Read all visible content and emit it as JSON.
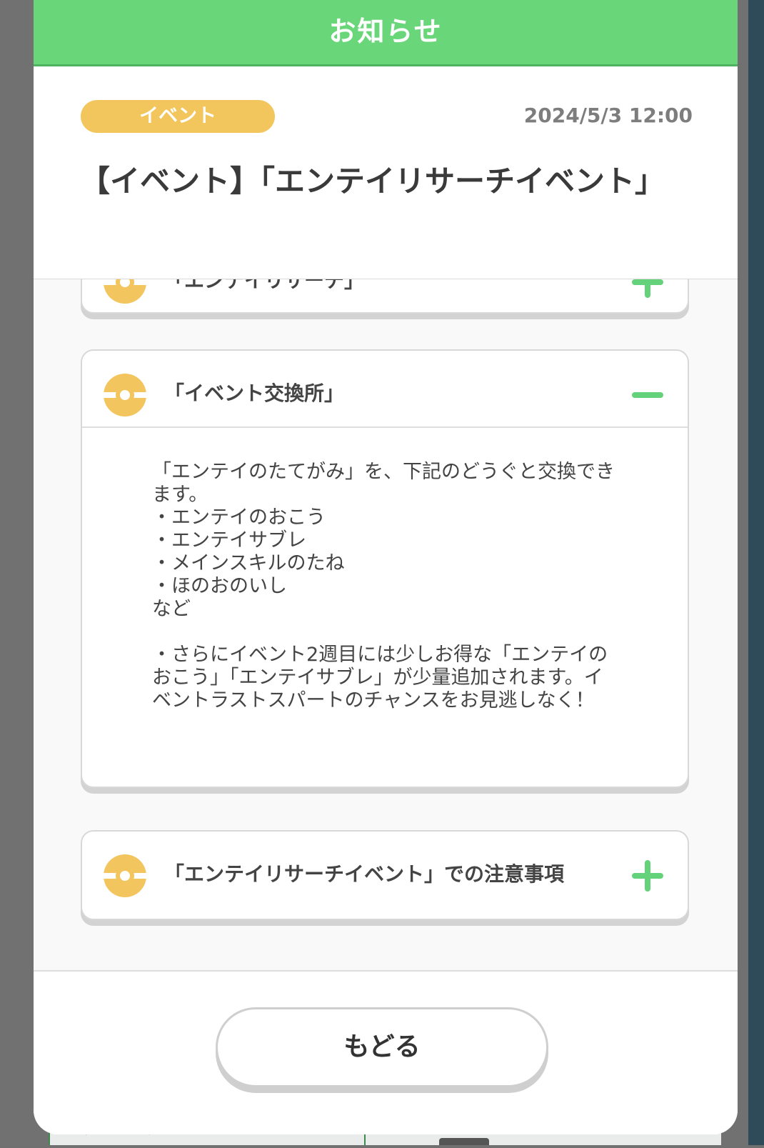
{
  "dialog": {
    "title": "お知らせ"
  },
  "post": {
    "category": "イベント",
    "date": "2024/5/3 12:00",
    "title": "【イベント】「エンテイリサーチイベント」"
  },
  "accordion": {
    "prev_label": "「エンテイリサーチ」",
    "exchange": {
      "label": "「イベント交換所」",
      "body": "「エンテイのたてがみ」を、下記のどうぐと交換できます。\n・エンテイのおこう\n・エンテイサブレ\n・メインスキルのたね\n・ほのおのいし\nなど\n\n・さらにイベント2週目には少しお得な「エンテイのおこう」「エンテイサブレ」が少量追加されます。イベントラストスパートのチャンスをお見逃しなく！"
    },
    "notes": {
      "label": "「エンテイリサーチイベント」での注意事項"
    }
  },
  "footer": {
    "back_label": "もどる"
  },
  "colors": {
    "header_green": "#69d67a",
    "badge_yellow": "#f2c65c",
    "icon_orange": "#f3c55f",
    "toggle_green": "#64d27a"
  }
}
